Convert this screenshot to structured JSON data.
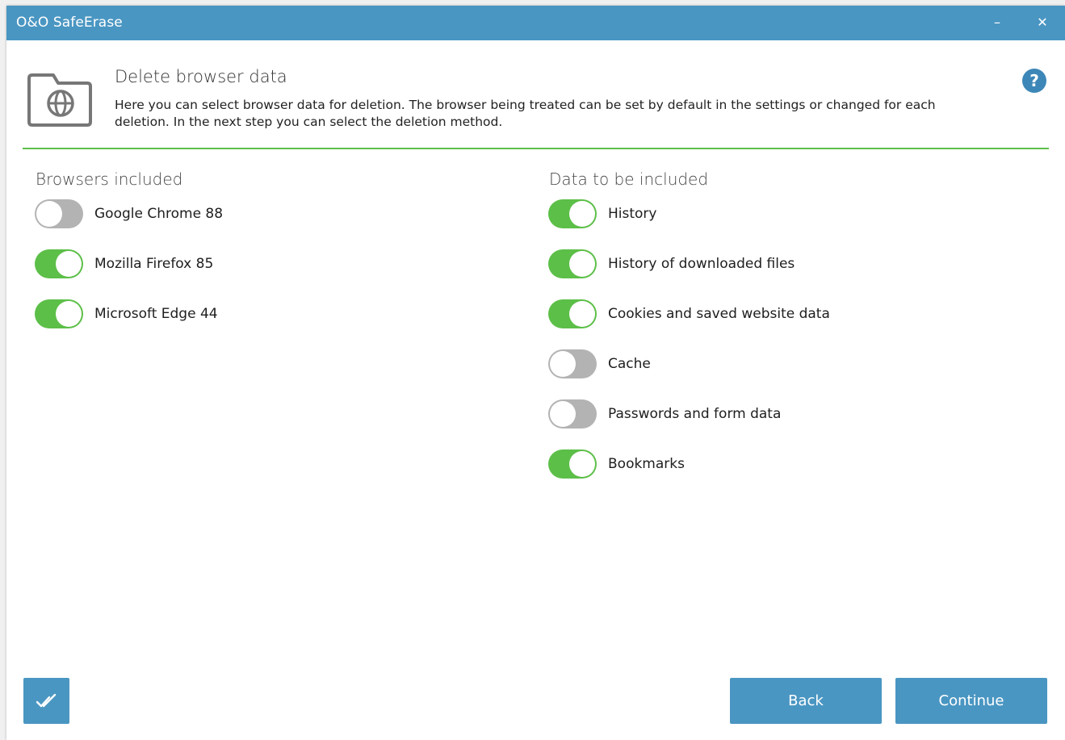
{
  "window": {
    "title": "O&O SafeErase",
    "minimize_label": "–",
    "close_label": "✕"
  },
  "header": {
    "icon": "folder-globe-icon",
    "title": "Delete browser data",
    "description": "Here you can select browser data for deletion. The browser being treated can be set by default in the settings or changed for each deletion. In the next step you can select the deletion method.",
    "help_label": "?"
  },
  "browsers": {
    "label": "Browsers included",
    "items": [
      {
        "label": "Google Chrome 88",
        "enabled": false
      },
      {
        "label": "Mozilla Firefox 85",
        "enabled": true
      },
      {
        "label": "Microsoft Edge 44",
        "enabled": true
      }
    ]
  },
  "data_types": {
    "label": "Data to be included",
    "items": [
      {
        "label": "History",
        "enabled": true
      },
      {
        "label": "History of downloaded files",
        "enabled": true
      },
      {
        "label": "Cookies and saved website data",
        "enabled": true
      },
      {
        "label": "Cache",
        "enabled": false
      },
      {
        "label": "Passwords and form data",
        "enabled": false
      },
      {
        "label": "Bookmarks",
        "enabled": true
      }
    ]
  },
  "footer": {
    "check_icon": "double-check-icon",
    "back_label": "Back",
    "continue_label": "Continue"
  },
  "colors": {
    "accent": "#4a96c2",
    "toggle_on": "#5cbf48",
    "toggle_off": "#b3b3b3",
    "divider": "#5cbf48"
  }
}
